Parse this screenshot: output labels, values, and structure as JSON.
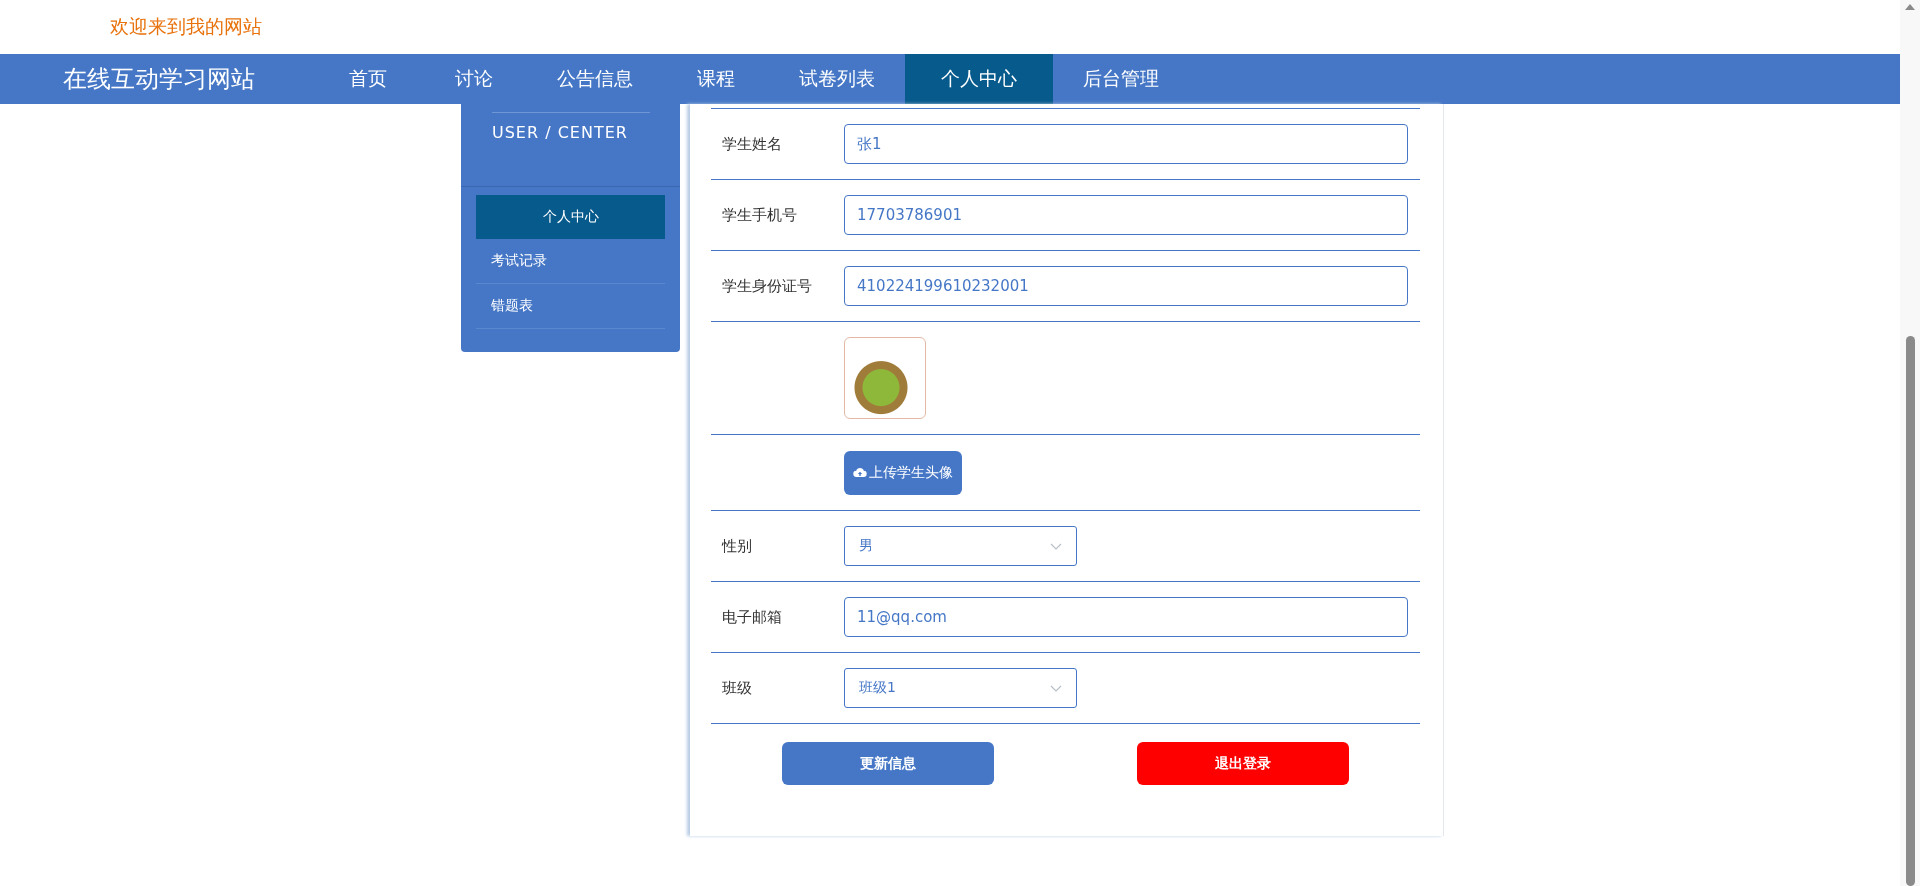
{
  "header": {
    "welcome": "欢迎来到我的网站"
  },
  "navbar": {
    "brand": "在线互动学习网站",
    "items": [
      {
        "label": "首页",
        "selected": false
      },
      {
        "label": "讨论",
        "selected": false
      },
      {
        "label": "公告信息",
        "selected": false
      },
      {
        "label": "课程",
        "selected": false
      },
      {
        "label": "试卷列表",
        "selected": false
      },
      {
        "label": "个人中心",
        "selected": true
      },
      {
        "label": "后台管理",
        "selected": false
      }
    ]
  },
  "sidebar": {
    "title": "USER / CENTER",
    "items": [
      {
        "label": "个人中心",
        "selected": true
      },
      {
        "label": "考试记录",
        "selected": false
      },
      {
        "label": "错题表",
        "selected": false
      }
    ]
  },
  "form": {
    "fields": [
      {
        "kind": "text",
        "label": "学生姓名",
        "value": "张1"
      },
      {
        "kind": "text",
        "label": "学生手机号",
        "value": "17703786901"
      },
      {
        "kind": "text",
        "label": "学生身份证号",
        "value": "410224199610232001"
      },
      {
        "kind": "image"
      },
      {
        "kind": "upload",
        "button": "上传学生头像"
      },
      {
        "kind": "select",
        "label": "性别",
        "value": "男"
      },
      {
        "kind": "text",
        "label": "电子邮箱",
        "value": "11@qq.com"
      },
      {
        "kind": "select",
        "label": "班级",
        "value": "班级1"
      }
    ],
    "buttons": [
      {
        "label": "更新信息",
        "kind": "primary"
      },
      {
        "label": "退出登录",
        "kind": "danger"
      }
    ]
  }
}
